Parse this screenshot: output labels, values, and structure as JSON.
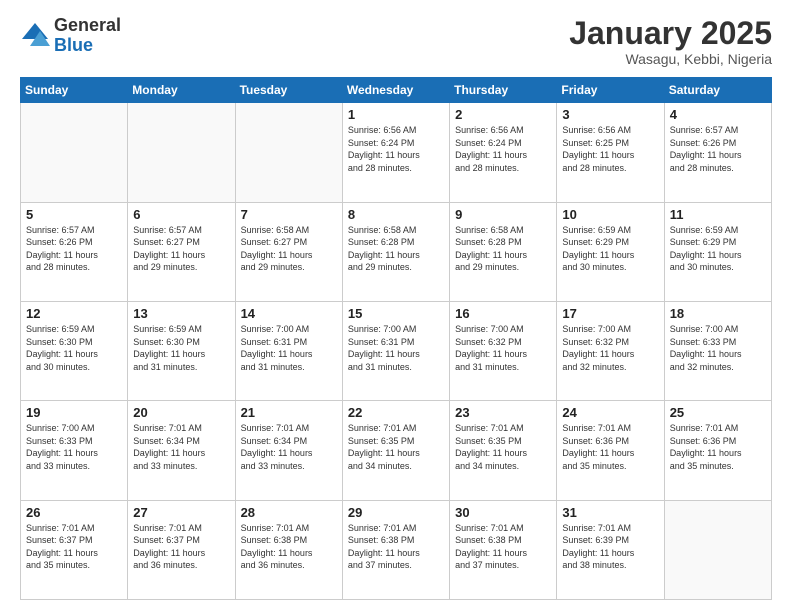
{
  "logo": {
    "general": "General",
    "blue": "Blue"
  },
  "header": {
    "month": "January 2025",
    "location": "Wasagu, Kebbi, Nigeria"
  },
  "weekdays": [
    "Sunday",
    "Monday",
    "Tuesday",
    "Wednesday",
    "Thursday",
    "Friday",
    "Saturday"
  ],
  "weeks": [
    [
      {
        "day": "",
        "info": ""
      },
      {
        "day": "",
        "info": ""
      },
      {
        "day": "",
        "info": ""
      },
      {
        "day": "1",
        "info": "Sunrise: 6:56 AM\nSunset: 6:24 PM\nDaylight: 11 hours\nand 28 minutes."
      },
      {
        "day": "2",
        "info": "Sunrise: 6:56 AM\nSunset: 6:24 PM\nDaylight: 11 hours\nand 28 minutes."
      },
      {
        "day": "3",
        "info": "Sunrise: 6:56 AM\nSunset: 6:25 PM\nDaylight: 11 hours\nand 28 minutes."
      },
      {
        "day": "4",
        "info": "Sunrise: 6:57 AM\nSunset: 6:26 PM\nDaylight: 11 hours\nand 28 minutes."
      }
    ],
    [
      {
        "day": "5",
        "info": "Sunrise: 6:57 AM\nSunset: 6:26 PM\nDaylight: 11 hours\nand 28 minutes."
      },
      {
        "day": "6",
        "info": "Sunrise: 6:57 AM\nSunset: 6:27 PM\nDaylight: 11 hours\nand 29 minutes."
      },
      {
        "day": "7",
        "info": "Sunrise: 6:58 AM\nSunset: 6:27 PM\nDaylight: 11 hours\nand 29 minutes."
      },
      {
        "day": "8",
        "info": "Sunrise: 6:58 AM\nSunset: 6:28 PM\nDaylight: 11 hours\nand 29 minutes."
      },
      {
        "day": "9",
        "info": "Sunrise: 6:58 AM\nSunset: 6:28 PM\nDaylight: 11 hours\nand 29 minutes."
      },
      {
        "day": "10",
        "info": "Sunrise: 6:59 AM\nSunset: 6:29 PM\nDaylight: 11 hours\nand 30 minutes."
      },
      {
        "day": "11",
        "info": "Sunrise: 6:59 AM\nSunset: 6:29 PM\nDaylight: 11 hours\nand 30 minutes."
      }
    ],
    [
      {
        "day": "12",
        "info": "Sunrise: 6:59 AM\nSunset: 6:30 PM\nDaylight: 11 hours\nand 30 minutes."
      },
      {
        "day": "13",
        "info": "Sunrise: 6:59 AM\nSunset: 6:30 PM\nDaylight: 11 hours\nand 31 minutes."
      },
      {
        "day": "14",
        "info": "Sunrise: 7:00 AM\nSunset: 6:31 PM\nDaylight: 11 hours\nand 31 minutes."
      },
      {
        "day": "15",
        "info": "Sunrise: 7:00 AM\nSunset: 6:31 PM\nDaylight: 11 hours\nand 31 minutes."
      },
      {
        "day": "16",
        "info": "Sunrise: 7:00 AM\nSunset: 6:32 PM\nDaylight: 11 hours\nand 31 minutes."
      },
      {
        "day": "17",
        "info": "Sunrise: 7:00 AM\nSunset: 6:32 PM\nDaylight: 11 hours\nand 32 minutes."
      },
      {
        "day": "18",
        "info": "Sunrise: 7:00 AM\nSunset: 6:33 PM\nDaylight: 11 hours\nand 32 minutes."
      }
    ],
    [
      {
        "day": "19",
        "info": "Sunrise: 7:00 AM\nSunset: 6:33 PM\nDaylight: 11 hours\nand 33 minutes."
      },
      {
        "day": "20",
        "info": "Sunrise: 7:01 AM\nSunset: 6:34 PM\nDaylight: 11 hours\nand 33 minutes."
      },
      {
        "day": "21",
        "info": "Sunrise: 7:01 AM\nSunset: 6:34 PM\nDaylight: 11 hours\nand 33 minutes."
      },
      {
        "day": "22",
        "info": "Sunrise: 7:01 AM\nSunset: 6:35 PM\nDaylight: 11 hours\nand 34 minutes."
      },
      {
        "day": "23",
        "info": "Sunrise: 7:01 AM\nSunset: 6:35 PM\nDaylight: 11 hours\nand 34 minutes."
      },
      {
        "day": "24",
        "info": "Sunrise: 7:01 AM\nSunset: 6:36 PM\nDaylight: 11 hours\nand 35 minutes."
      },
      {
        "day": "25",
        "info": "Sunrise: 7:01 AM\nSunset: 6:36 PM\nDaylight: 11 hours\nand 35 minutes."
      }
    ],
    [
      {
        "day": "26",
        "info": "Sunrise: 7:01 AM\nSunset: 6:37 PM\nDaylight: 11 hours\nand 35 minutes."
      },
      {
        "day": "27",
        "info": "Sunrise: 7:01 AM\nSunset: 6:37 PM\nDaylight: 11 hours\nand 36 minutes."
      },
      {
        "day": "28",
        "info": "Sunrise: 7:01 AM\nSunset: 6:38 PM\nDaylight: 11 hours\nand 36 minutes."
      },
      {
        "day": "29",
        "info": "Sunrise: 7:01 AM\nSunset: 6:38 PM\nDaylight: 11 hours\nand 37 minutes."
      },
      {
        "day": "30",
        "info": "Sunrise: 7:01 AM\nSunset: 6:38 PM\nDaylight: 11 hours\nand 37 minutes."
      },
      {
        "day": "31",
        "info": "Sunrise: 7:01 AM\nSunset: 6:39 PM\nDaylight: 11 hours\nand 38 minutes."
      },
      {
        "day": "",
        "info": ""
      }
    ]
  ]
}
